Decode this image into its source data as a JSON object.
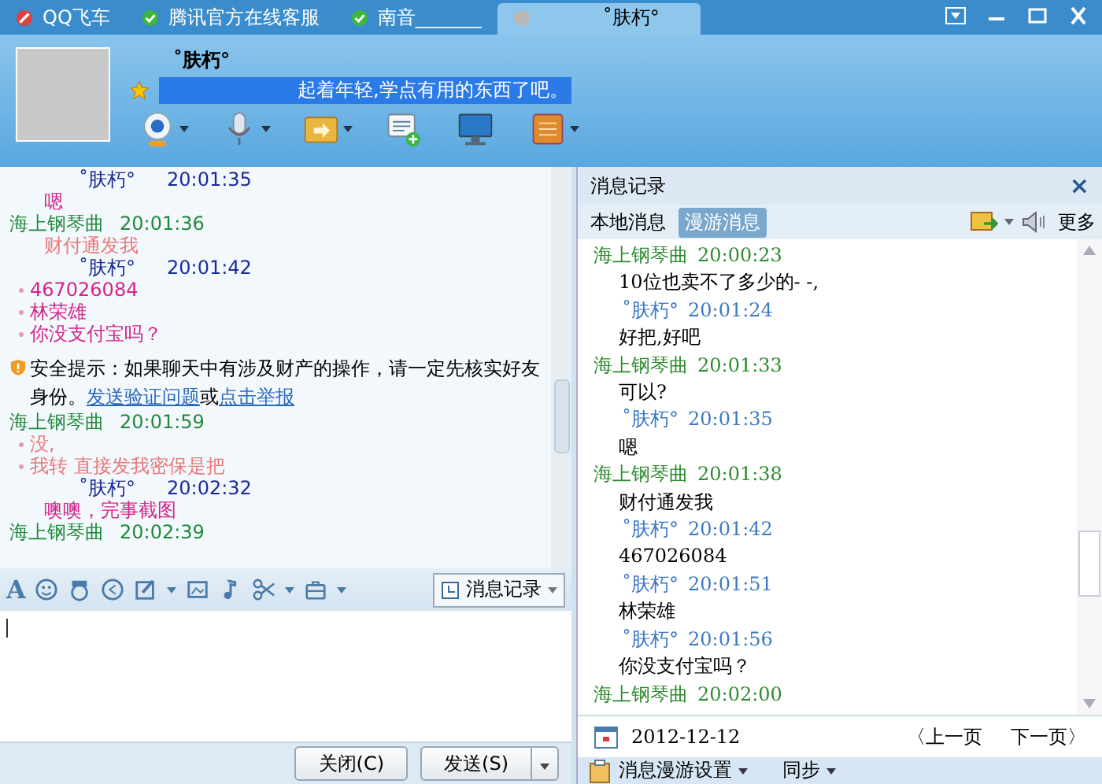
{
  "tabs": [
    {
      "label": "QQ飞车",
      "kind": "busy",
      "selected": false
    },
    {
      "label": "腾讯官方在线客服",
      "kind": "online",
      "selected": false
    },
    {
      "label": "南音_______",
      "kind": "online",
      "selected": false
    },
    {
      "label": "˚肤朽°",
      "kind": "offline",
      "selected": true
    }
  ],
  "font_button": "A",
  "contact": {
    "name": "˚肤朽°",
    "signature": "起着年轻,学点有用的东西了吧。",
    "signature_selected": true
  },
  "chat": [
    {
      "kind": "self",
      "name": "˚肤朽°",
      "time": "20:01:35"
    },
    {
      "kind": "text",
      "text": "嗯",
      "color": "#d4238c",
      "bullet": false
    },
    {
      "kind": "friend",
      "name": "海上钢琴曲",
      "time": "20:01:36"
    },
    {
      "kind": "text",
      "text": "财付通发我",
      "color": "#e8787a",
      "bullet": false
    },
    {
      "kind": "self",
      "name": "˚肤朽°",
      "time": "20:01:42"
    },
    {
      "kind": "text",
      "text": "467026084",
      "color": "#d4238c",
      "bullet": true
    },
    {
      "kind": "text",
      "text": "林荣雄",
      "color": "#d4238c",
      "bullet": true
    },
    {
      "kind": "text",
      "text": "你没支付宝吗？",
      "color": "#d4238c",
      "bullet": true
    },
    {
      "kind": "notice",
      "text": "安全提示：如果聊天中有涉及财产的操作，请一定先核实好友身份。",
      "link1": "发送验证问题",
      "joiner": "或",
      "link2": "点击举报"
    },
    {
      "kind": "friend",
      "name": "海上钢琴曲",
      "time": "20:01:59"
    },
    {
      "kind": "text",
      "text": "没,",
      "color": "#e8787a",
      "bullet": true
    },
    {
      "kind": "text",
      "text": "我转 直接发我密保是把",
      "color": "#e8787a",
      "bullet": true
    },
    {
      "kind": "self",
      "name": "˚肤朽°",
      "time": "20:02:32"
    },
    {
      "kind": "text",
      "text": "噢噢，完事截图",
      "color": "#d4238c",
      "bullet": false
    },
    {
      "kind": "friend",
      "name": "海上钢琴曲",
      "time": "20:02:39"
    }
  ],
  "history_button": "消息记录",
  "buttons": {
    "close": "关闭(C)",
    "send": "发送(S)"
  },
  "history": {
    "title": "消息记录",
    "close": "×",
    "tabs": [
      {
        "label": "本地消息",
        "selected": false
      },
      {
        "label": "漫游消息",
        "selected": true
      }
    ],
    "more": "更多",
    "entries": [
      {
        "kind": "friend",
        "name": "海上钢琴曲",
        "time": "20:00:23"
      },
      {
        "kind": "text",
        "text": "10位也卖不了多少的- -,"
      },
      {
        "kind": "self",
        "name": "˚肤朽°",
        "time": "20:01:24"
      },
      {
        "kind": "text",
        "text": "好把,好吧"
      },
      {
        "kind": "friend",
        "name": "海上钢琴曲",
        "time": "20:01:33"
      },
      {
        "kind": "text",
        "text": "可以?"
      },
      {
        "kind": "self",
        "name": "˚肤朽°",
        "time": "20:01:35"
      },
      {
        "kind": "text",
        "text": "嗯"
      },
      {
        "kind": "friend",
        "name": "海上钢琴曲",
        "time": "20:01:38"
      },
      {
        "kind": "text",
        "text": "财付通发我"
      },
      {
        "kind": "self",
        "name": "˚肤朽°",
        "time": "20:01:42"
      },
      {
        "kind": "text",
        "text": "467026084"
      },
      {
        "kind": "self",
        "name": "˚肤朽°",
        "time": "20:01:51"
      },
      {
        "kind": "text",
        "text": "林荣雄"
      },
      {
        "kind": "self",
        "name": "˚肤朽°",
        "time": "20:01:56"
      },
      {
        "kind": "text",
        "text": "你没支付宝吗？"
      },
      {
        "kind": "friend",
        "name": "海上钢琴曲",
        "time": "20:02:00"
      }
    ],
    "date": "2012-12-12",
    "prev": "〈上一页",
    "next": "下一页〉",
    "settings": "消息漫游设置",
    "sync": "同步"
  }
}
